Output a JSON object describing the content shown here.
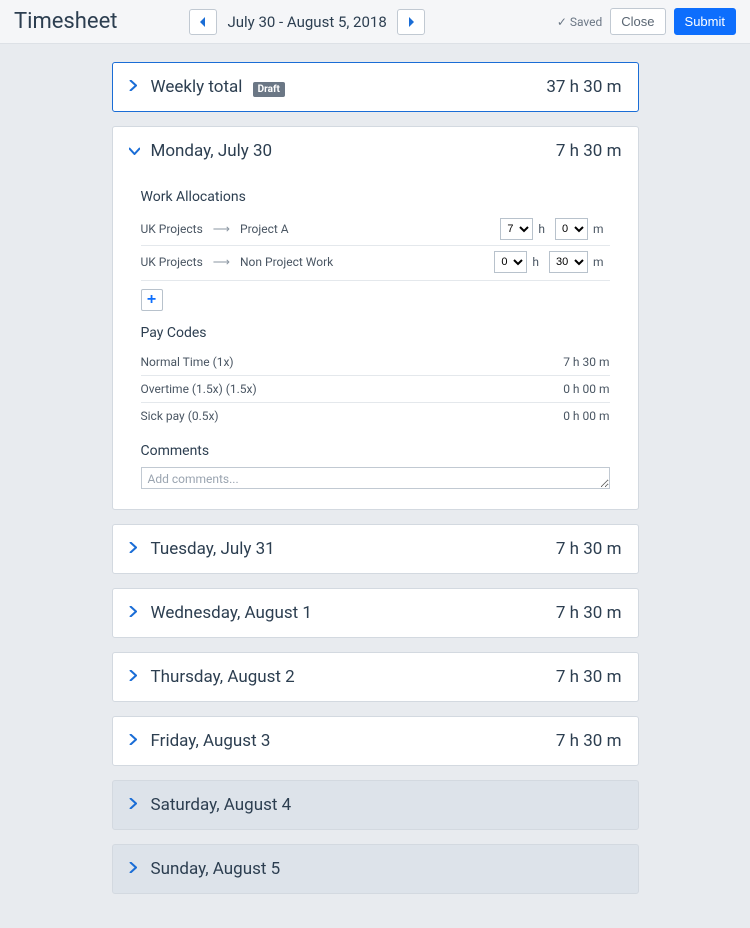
{
  "header": {
    "title": "Timesheet",
    "date_range": "July 30 - August 5, 2018",
    "saved_label": "Saved",
    "close_label": "Close",
    "submit_label": "Submit"
  },
  "weekly": {
    "label": "Weekly total",
    "badge": "Draft",
    "total": "37 h 30 m"
  },
  "monday": {
    "title": "Monday, July 30",
    "total": "7 h 30 m",
    "sections": {
      "allocations": "Work Allocations",
      "paycodes": "Pay Codes",
      "comments": "Comments"
    },
    "allocations": [
      {
        "group": "UK Projects",
        "project": "Project A",
        "hours": "7",
        "minutes": "0"
      },
      {
        "group": "UK Projects",
        "project": "Non Project Work",
        "hours": "0",
        "minutes": "30"
      }
    ],
    "h_label": "h",
    "m_label": "m",
    "paycodes": [
      {
        "name": "Normal Time (1x)",
        "value": "7 h 30 m"
      },
      {
        "name": "Overtime (1.5x) (1.5x)",
        "value": "0 h 00 m"
      },
      {
        "name": "Sick pay (0.5x)",
        "value": "0 h 00 m"
      }
    ],
    "comments_placeholder": "Add comments..."
  },
  "days": [
    {
      "title": "Tuesday, July 31",
      "total": "7 h 30 m",
      "weekend": false
    },
    {
      "title": "Wednesday, August 1",
      "total": "7 h 30 m",
      "weekend": false
    },
    {
      "title": "Thursday, August 2",
      "total": "7 h 30 m",
      "weekend": false
    },
    {
      "title": "Friday, August 3",
      "total": "7 h 30 m",
      "weekend": false
    },
    {
      "title": "Saturday, August 4",
      "total": "",
      "weekend": true
    },
    {
      "title": "Sunday, August 5",
      "total": "",
      "weekend": true
    }
  ]
}
